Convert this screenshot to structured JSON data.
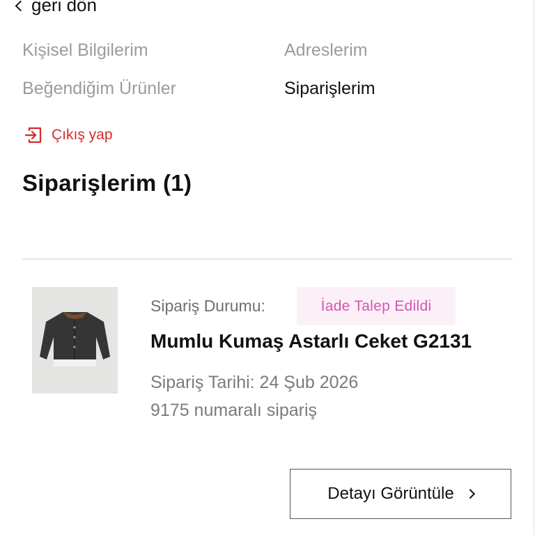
{
  "nav": {
    "back_label": "geri dön"
  },
  "account_menu": {
    "items": [
      {
        "label": "Kişisel Bilgilerim",
        "active": false
      },
      {
        "label": "Adreslerim",
        "active": false
      },
      {
        "label": "Beğendiğim Ürünler",
        "active": false
      },
      {
        "label": "Siparişlerim",
        "active": true
      }
    ],
    "logout_label": "Çıkış yap"
  },
  "orders": {
    "title": "Siparişlerim (1)",
    "list": [
      {
        "status_label": "Sipariş Durumu:",
        "status_value": "İade Talep Edildi",
        "product_name": "Mumlu Kumaş Astarlı Ceket G2131",
        "date_text": "Sipariş Tarihi: 24 Şub 2026",
        "order_number_text": "9175 numaralı sipariş",
        "detail_button_label": "Detayı Görüntüle"
      }
    ]
  },
  "colors": {
    "accent_red": "#d42b2b",
    "status_badge_bg": "#fcf0f8",
    "status_badge_text": "#d256b3",
    "muted_text": "#9b9b9b"
  }
}
